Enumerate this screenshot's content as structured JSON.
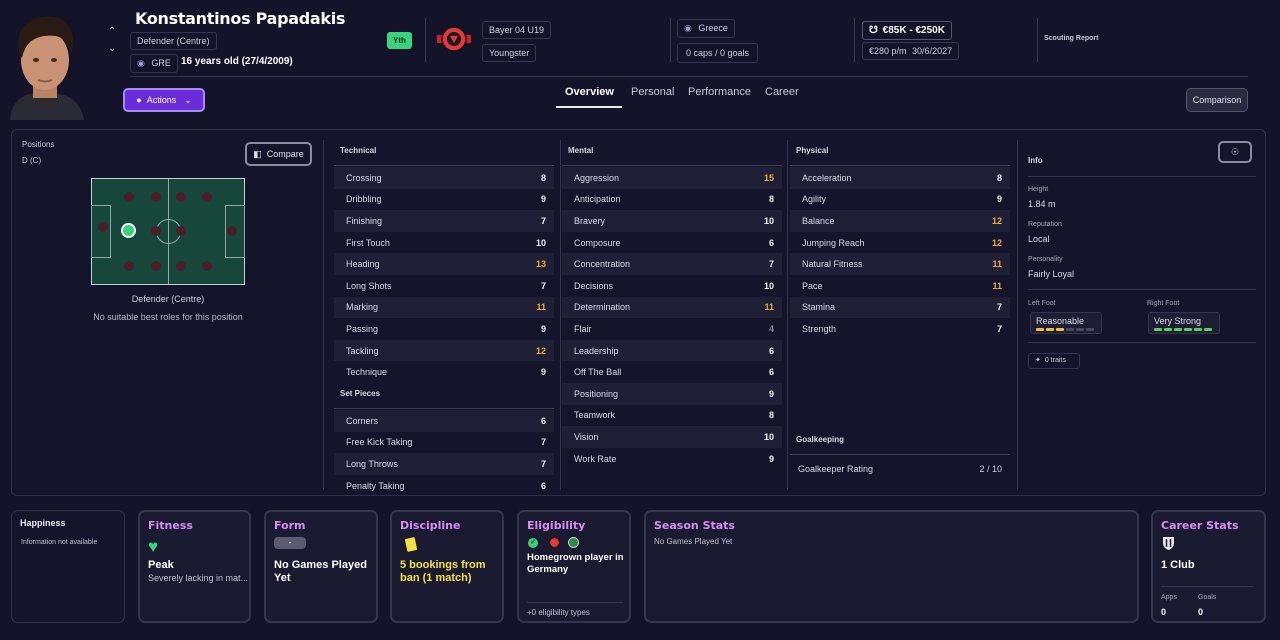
{
  "player": {
    "name": "Konstantinos Papadakis",
    "position": "Defender (Centre)",
    "nationality_code": "GRE",
    "age_text": "16 years old (27/4/2009)",
    "squad_badge": "Yth"
  },
  "club": {
    "name": "Bayer 04 U19",
    "status": "Youngster"
  },
  "nation": {
    "name": "Greece",
    "caps": "0 caps / 0 goals"
  },
  "value": {
    "range": "€85K - €250K",
    "wage": "€280 p/m",
    "contract": "30/6/2027"
  },
  "header": {
    "scouting_report": "Scouting Report",
    "actions_label": "Actions",
    "comparison_label": "Comparison"
  },
  "tabs": [
    {
      "label": "Overview",
      "active": true
    },
    {
      "label": "Personal"
    },
    {
      "label": "Performance"
    },
    {
      "label": "Career"
    }
  ],
  "positions_panel": {
    "title": "Positions",
    "current": "D (C)",
    "compare_label": "Compare",
    "pitch_role": "Defender (Centre)",
    "best_roles": "No suitable best roles for this position"
  },
  "technical": {
    "title": "Technical",
    "items": [
      {
        "name": "Crossing",
        "value": "8"
      },
      {
        "name": "Dribbling",
        "value": "9"
      },
      {
        "name": "Finishing",
        "value": "7"
      },
      {
        "name": "First Touch",
        "value": "10"
      },
      {
        "name": "Heading",
        "value": "13"
      },
      {
        "name": "Long Shots",
        "value": "7"
      },
      {
        "name": "Marking",
        "value": "11"
      },
      {
        "name": "Passing",
        "value": "9"
      },
      {
        "name": "Tackling",
        "value": "12"
      },
      {
        "name": "Technique",
        "value": "9"
      }
    ]
  },
  "set_pieces": {
    "title": "Set Pieces",
    "items": [
      {
        "name": "Corners",
        "value": "6"
      },
      {
        "name": "Free Kick Taking",
        "value": "7"
      },
      {
        "name": "Long Throws",
        "value": "7"
      },
      {
        "name": "Penalty Taking",
        "value": "6"
      }
    ]
  },
  "mental": {
    "title": "Mental",
    "items": [
      {
        "name": "Aggression",
        "value": "15"
      },
      {
        "name": "Anticipation",
        "value": "8"
      },
      {
        "name": "Bravery",
        "value": "10"
      },
      {
        "name": "Composure",
        "value": "6"
      },
      {
        "name": "Concentration",
        "value": "7"
      },
      {
        "name": "Decisions",
        "value": "10"
      },
      {
        "name": "Determination",
        "value": "11"
      },
      {
        "name": "Flair",
        "value": "4"
      },
      {
        "name": "Leadership",
        "value": "6"
      },
      {
        "name": "Off The Ball",
        "value": "6"
      },
      {
        "name": "Positioning",
        "value": "9"
      },
      {
        "name": "Teamwork",
        "value": "8"
      },
      {
        "name": "Vision",
        "value": "10"
      },
      {
        "name": "Work Rate",
        "value": "9"
      }
    ]
  },
  "physical": {
    "title": "Physical",
    "items": [
      {
        "name": "Acceleration",
        "value": "8"
      },
      {
        "name": "Agility",
        "value": "9"
      },
      {
        "name": "Balance",
        "value": "12"
      },
      {
        "name": "Jumping Reach",
        "value": "12"
      },
      {
        "name": "Natural Fitness",
        "value": "11"
      },
      {
        "name": "Pace",
        "value": "11"
      },
      {
        "name": "Stamina",
        "value": "7"
      },
      {
        "name": "Strength",
        "value": "7"
      }
    ]
  },
  "goalkeeping": {
    "title": "Goalkeeping",
    "rating_label": "Goalkeeper Rating",
    "rating_value": "2 / 10"
  },
  "info": {
    "title": "Info",
    "height_label": "Height",
    "height": "1.84 m",
    "reputation_label": "Reputation",
    "reputation": "Local",
    "personality_label": "Personality",
    "personality": "Fairly Loyal",
    "left_foot_label": "Left Foot",
    "left_foot": "Reasonable",
    "left_foot_level": 3,
    "left_foot_color": "#f2c12e",
    "right_foot_label": "Right Foot",
    "right_foot": "Very Strong",
    "right_foot_level": 6,
    "right_foot_color": "#58d05a",
    "traits": "0 traits"
  },
  "cards": {
    "happiness": {
      "title": "Happiness",
      "text": "Information not available"
    },
    "fitness": {
      "title": "Fitness",
      "value": "Peak",
      "text": "Severely lacking in mat..."
    },
    "form": {
      "title": "Form",
      "badge": "-",
      "value": "No Games Played Yet"
    },
    "discipline": {
      "title": "Discipline",
      "value": "5 bookings from ban (1 match)"
    },
    "eligibility": {
      "title": "Eligibility",
      "value": "Homegrown player in Germany",
      "footer": "+0 eligibility types"
    },
    "season_stats": {
      "title": "Season Stats",
      "text": "No Games Played Yet"
    },
    "career_stats": {
      "title": "Career Stats",
      "clubs": "1 Club",
      "apps_label": "Apps",
      "apps": "0",
      "goals_label": "Goals",
      "goals": "0"
    }
  },
  "colors": {
    "accent": "#d98cf5",
    "highlight": "#f2a93b",
    "action_purple": "#6a2bd8",
    "pitch": "#17473a"
  }
}
